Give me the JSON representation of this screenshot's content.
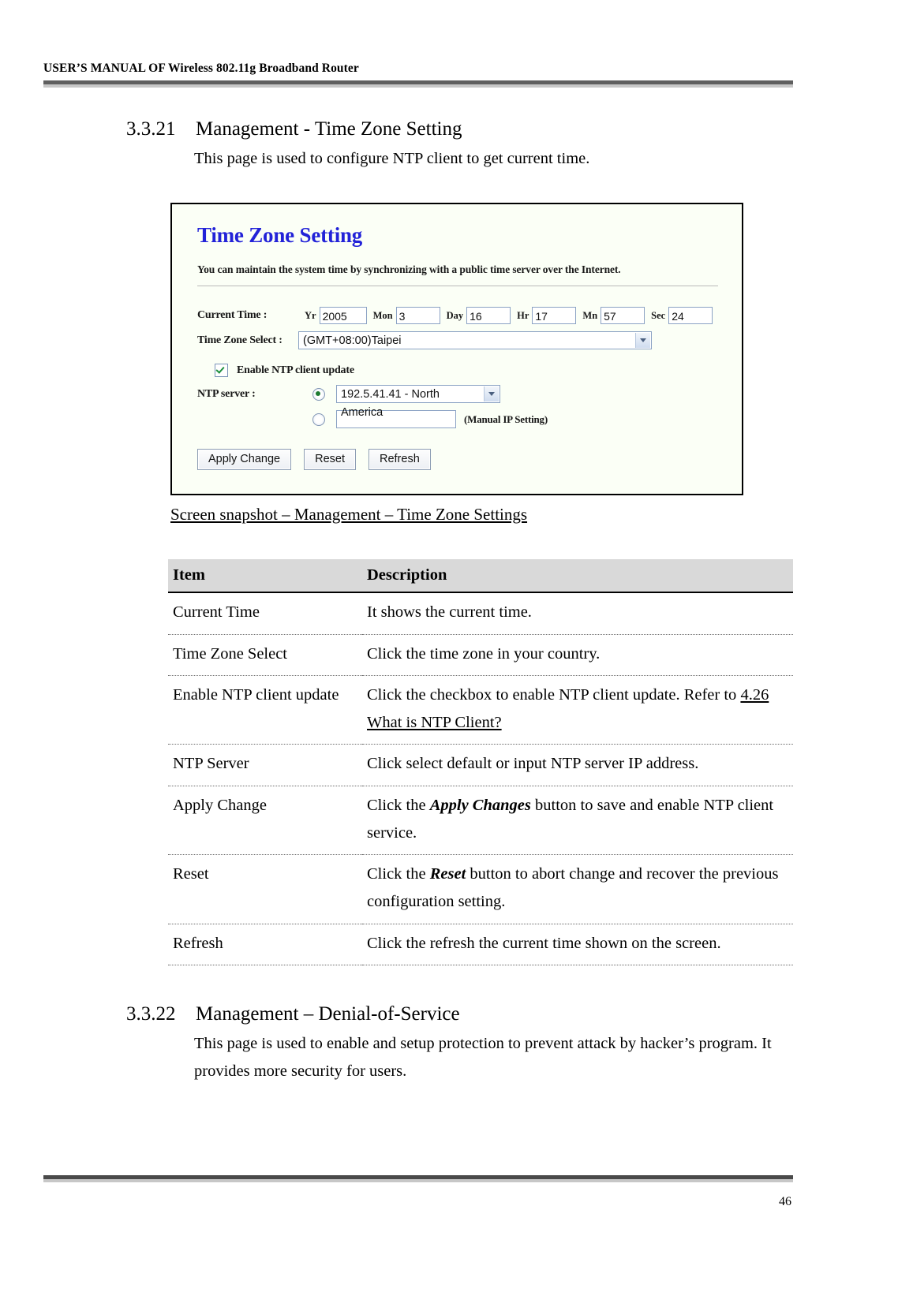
{
  "header": {
    "title": "USER’S MANUAL OF Wireless 802.11g Broadband Router"
  },
  "footer": {
    "page_number": "46"
  },
  "sections": [
    {
      "number": "3.3.21",
      "title": "Management - Time Zone Setting",
      "paragraph": "This page is used to configure NTP client to get current time."
    },
    {
      "number": "3.3.22",
      "title": "Management – Denial-of-Service",
      "paragraph": "This page is used to enable and setup protection to prevent attack by hacker’s program. It provides more security for users."
    }
  ],
  "screenshot": {
    "title": "Time Zone Setting",
    "description": "You can maintain the system time by synchronizing with a public time server over the Internet.",
    "current_time_label": "Current Time :",
    "time_fields": [
      {
        "abbr": "Yr",
        "value": "2005"
      },
      {
        "abbr": "Mon",
        "value": "3"
      },
      {
        "abbr": "Day",
        "value": "16"
      },
      {
        "abbr": "Hr",
        "value": "17"
      },
      {
        "abbr": "Mn",
        "value": "57"
      },
      {
        "abbr": "Sec",
        "value": "24"
      }
    ],
    "time_zone_label": "Time Zone Select :",
    "time_zone_value": "(GMT+08:00)Taipei",
    "enable_ntp_label": "Enable NTP client update",
    "enable_ntp_checked": true,
    "ntp_server_label": "NTP server :",
    "ntp_server_value": "192.5.41.41 - North America",
    "ntp_server_selected": true,
    "manual_ip_value": "",
    "manual_ip_note": "(Manual IP Setting)",
    "manual_ip_selected": false,
    "buttons": [
      {
        "label": "Apply Change"
      },
      {
        "label": "Reset"
      },
      {
        "label": "Refresh"
      }
    ],
    "caption": "Screen snapshot – Management – Time Zone Settings"
  },
  "table": {
    "headers": {
      "item": "Item",
      "description": "Description"
    },
    "rows": [
      {
        "item": "Current Time",
        "desc_pre": "It shows the current time.",
        "desc_link": "",
        "desc_post": ""
      },
      {
        "item": "Time Zone Select",
        "desc_pre": "Click the time zone in your country.",
        "desc_link": "",
        "desc_post": ""
      },
      {
        "item": "Enable NTP client update",
        "desc_pre": "Click the checkbox to enable NTP client update. Refer to ",
        "desc_link": "4.26 What is NTP Client?",
        "desc_post": ""
      },
      {
        "item": "NTP Server",
        "desc_pre": "Click select default or input NTP server IP address.",
        "desc_link": "",
        "desc_post": ""
      },
      {
        "item": "Apply Change",
        "desc_pre": "Click the ",
        "desc_bold": "Apply Changes",
        "desc_post": " button to save and enable NTP client service."
      },
      {
        "item": "Reset",
        "desc_pre": "Click the ",
        "desc_bold": "Reset",
        "desc_post": " button to abort change and recover the previous configuration setting."
      },
      {
        "item": "Refresh",
        "desc_pre": "Click the refresh the current time shown on the screen.",
        "desc_link": "",
        "desc_post": ""
      }
    ]
  }
}
